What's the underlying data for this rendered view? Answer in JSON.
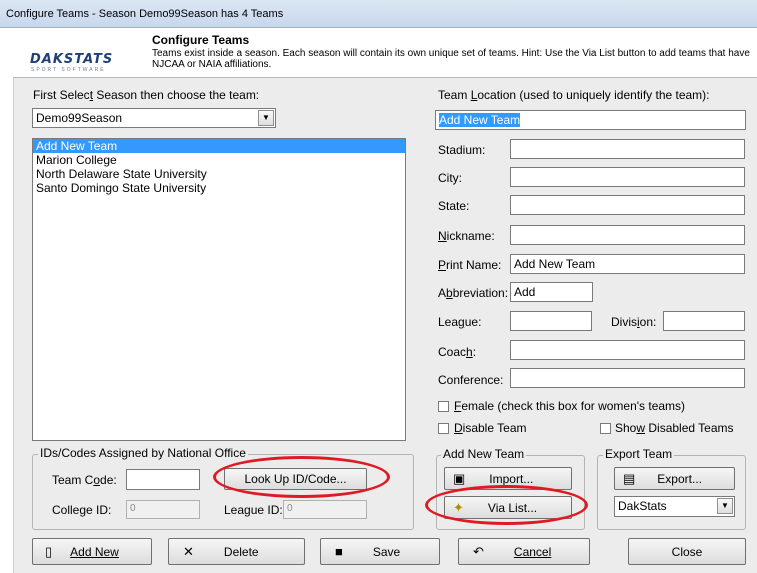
{
  "window": {
    "title": "Configure Teams - Season Demo99Season has 4 Teams"
  },
  "header": {
    "logo_main": "DAKSTATS",
    "logo_sub": "SPORT SOFTWARE",
    "title": "Configure Teams",
    "description": "Teams exist inside a season.  Each season will contain its own unique set of teams.  Hint: Use the Via List button to add teams that have NJCAA or NAIA affiliations."
  },
  "left": {
    "season_label": "First Select Season then choose the team:",
    "season_value": "Demo99Season",
    "teams": [
      "Add New Team",
      "Marion College",
      "North Delaware State University",
      "Santo Domingo State University"
    ],
    "selected_index": 0
  },
  "ids_group": {
    "label": "IDs/Codes Assigned by National Office",
    "team_code_label": "Team Code:",
    "team_code_value": "",
    "lookup_button": "Look Up ID/Code...",
    "college_id_label": "College ID:",
    "college_id_value": "0",
    "league_id_label": "League ID:",
    "league_id_value": "0"
  },
  "right": {
    "location_label": "Team Location (used to uniquely identify the team):",
    "location_value": "Add New Team",
    "stadium_label": "Stadium:",
    "stadium_value": "",
    "city_label": "City:",
    "city_value": "",
    "state_label": "State:",
    "state_value": "",
    "nickname_label": "Nickname:",
    "nickname_value": "",
    "print_name_label": "Print Name:",
    "print_name_value": "Add New Team",
    "abbreviation_label": "Abbreviation:",
    "abbreviation_value": "Add",
    "league_label": "League:",
    "league_value": "",
    "division_label": "Division:",
    "division_value": "",
    "coach_label": "Coach:",
    "coach_value": "",
    "conference_label": "Conference:",
    "conference_value": "",
    "female_label": "Female (check this box for women's teams)",
    "disable_label": "Disable Team",
    "show_disabled_label": "Show Disabled Teams"
  },
  "add_group": {
    "label": "Add New Team",
    "import_button": "Import...",
    "via_list_button": "Via List..."
  },
  "export_group": {
    "label": "Export Team",
    "export_button": "Export...",
    "format_value": "DakStats"
  },
  "bottom": {
    "add_new": "Add New",
    "delete": "Delete",
    "save": "Save",
    "cancel": "Cancel",
    "close": "Close"
  },
  "colors": {
    "selection": "#3399ff",
    "annotation": "#e01a24",
    "brand": "#1f3f77"
  }
}
